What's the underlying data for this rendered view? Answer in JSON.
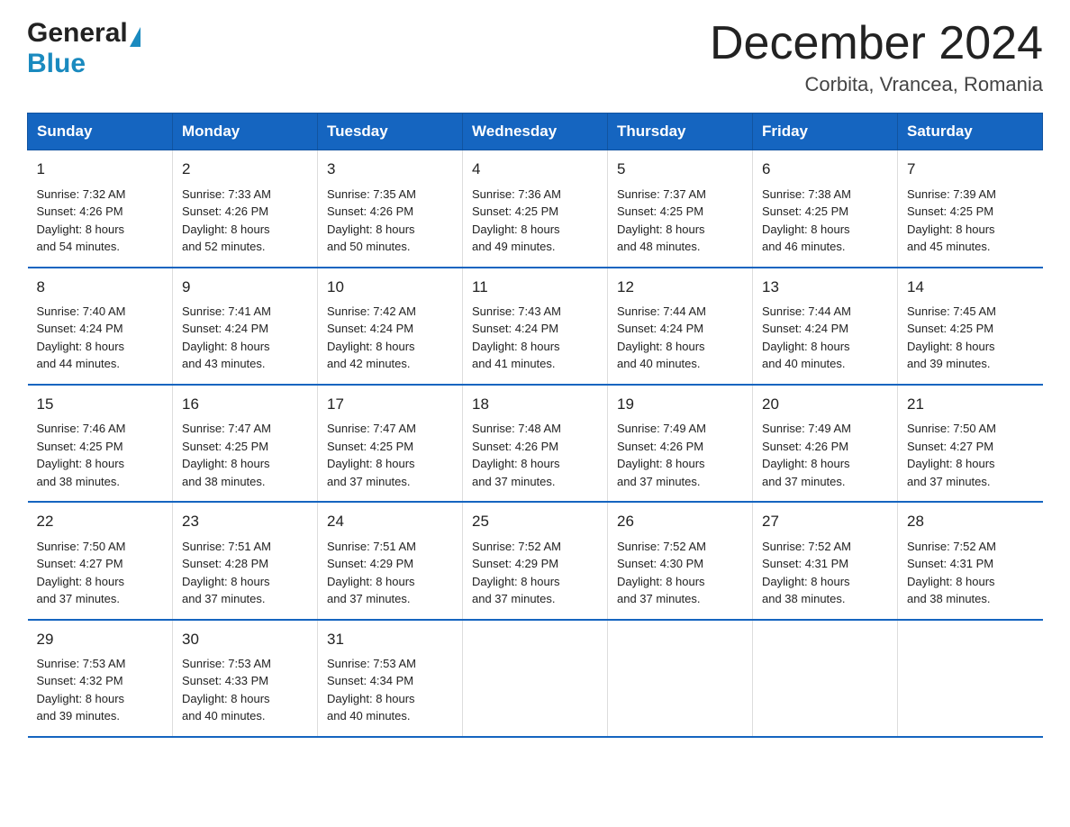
{
  "header": {
    "logo_general": "General",
    "logo_blue": "Blue",
    "title": "December 2024",
    "subtitle": "Corbita, Vrancea, Romania"
  },
  "days_of_week": [
    "Sunday",
    "Monday",
    "Tuesday",
    "Wednesday",
    "Thursday",
    "Friday",
    "Saturday"
  ],
  "weeks": [
    [
      {
        "day": "1",
        "sunrise": "Sunrise: 7:32 AM",
        "sunset": "Sunset: 4:26 PM",
        "daylight": "Daylight: 8 hours",
        "daylight2": "and 54 minutes."
      },
      {
        "day": "2",
        "sunrise": "Sunrise: 7:33 AM",
        "sunset": "Sunset: 4:26 PM",
        "daylight": "Daylight: 8 hours",
        "daylight2": "and 52 minutes."
      },
      {
        "day": "3",
        "sunrise": "Sunrise: 7:35 AM",
        "sunset": "Sunset: 4:26 PM",
        "daylight": "Daylight: 8 hours",
        "daylight2": "and 50 minutes."
      },
      {
        "day": "4",
        "sunrise": "Sunrise: 7:36 AM",
        "sunset": "Sunset: 4:25 PM",
        "daylight": "Daylight: 8 hours",
        "daylight2": "and 49 minutes."
      },
      {
        "day": "5",
        "sunrise": "Sunrise: 7:37 AM",
        "sunset": "Sunset: 4:25 PM",
        "daylight": "Daylight: 8 hours",
        "daylight2": "and 48 minutes."
      },
      {
        "day": "6",
        "sunrise": "Sunrise: 7:38 AM",
        "sunset": "Sunset: 4:25 PM",
        "daylight": "Daylight: 8 hours",
        "daylight2": "and 46 minutes."
      },
      {
        "day": "7",
        "sunrise": "Sunrise: 7:39 AM",
        "sunset": "Sunset: 4:25 PM",
        "daylight": "Daylight: 8 hours",
        "daylight2": "and 45 minutes."
      }
    ],
    [
      {
        "day": "8",
        "sunrise": "Sunrise: 7:40 AM",
        "sunset": "Sunset: 4:24 PM",
        "daylight": "Daylight: 8 hours",
        "daylight2": "and 44 minutes."
      },
      {
        "day": "9",
        "sunrise": "Sunrise: 7:41 AM",
        "sunset": "Sunset: 4:24 PM",
        "daylight": "Daylight: 8 hours",
        "daylight2": "and 43 minutes."
      },
      {
        "day": "10",
        "sunrise": "Sunrise: 7:42 AM",
        "sunset": "Sunset: 4:24 PM",
        "daylight": "Daylight: 8 hours",
        "daylight2": "and 42 minutes."
      },
      {
        "day": "11",
        "sunrise": "Sunrise: 7:43 AM",
        "sunset": "Sunset: 4:24 PM",
        "daylight": "Daylight: 8 hours",
        "daylight2": "and 41 minutes."
      },
      {
        "day": "12",
        "sunrise": "Sunrise: 7:44 AM",
        "sunset": "Sunset: 4:24 PM",
        "daylight": "Daylight: 8 hours",
        "daylight2": "and 40 minutes."
      },
      {
        "day": "13",
        "sunrise": "Sunrise: 7:44 AM",
        "sunset": "Sunset: 4:24 PM",
        "daylight": "Daylight: 8 hours",
        "daylight2": "and 40 minutes."
      },
      {
        "day": "14",
        "sunrise": "Sunrise: 7:45 AM",
        "sunset": "Sunset: 4:25 PM",
        "daylight": "Daylight: 8 hours",
        "daylight2": "and 39 minutes."
      }
    ],
    [
      {
        "day": "15",
        "sunrise": "Sunrise: 7:46 AM",
        "sunset": "Sunset: 4:25 PM",
        "daylight": "Daylight: 8 hours",
        "daylight2": "and 38 minutes."
      },
      {
        "day": "16",
        "sunrise": "Sunrise: 7:47 AM",
        "sunset": "Sunset: 4:25 PM",
        "daylight": "Daylight: 8 hours",
        "daylight2": "and 38 minutes."
      },
      {
        "day": "17",
        "sunrise": "Sunrise: 7:47 AM",
        "sunset": "Sunset: 4:25 PM",
        "daylight": "Daylight: 8 hours",
        "daylight2": "and 37 minutes."
      },
      {
        "day": "18",
        "sunrise": "Sunrise: 7:48 AM",
        "sunset": "Sunset: 4:26 PM",
        "daylight": "Daylight: 8 hours",
        "daylight2": "and 37 minutes."
      },
      {
        "day": "19",
        "sunrise": "Sunrise: 7:49 AM",
        "sunset": "Sunset: 4:26 PM",
        "daylight": "Daylight: 8 hours",
        "daylight2": "and 37 minutes."
      },
      {
        "day": "20",
        "sunrise": "Sunrise: 7:49 AM",
        "sunset": "Sunset: 4:26 PM",
        "daylight": "Daylight: 8 hours",
        "daylight2": "and 37 minutes."
      },
      {
        "day": "21",
        "sunrise": "Sunrise: 7:50 AM",
        "sunset": "Sunset: 4:27 PM",
        "daylight": "Daylight: 8 hours",
        "daylight2": "and 37 minutes."
      }
    ],
    [
      {
        "day": "22",
        "sunrise": "Sunrise: 7:50 AM",
        "sunset": "Sunset: 4:27 PM",
        "daylight": "Daylight: 8 hours",
        "daylight2": "and 37 minutes."
      },
      {
        "day": "23",
        "sunrise": "Sunrise: 7:51 AM",
        "sunset": "Sunset: 4:28 PM",
        "daylight": "Daylight: 8 hours",
        "daylight2": "and 37 minutes."
      },
      {
        "day": "24",
        "sunrise": "Sunrise: 7:51 AM",
        "sunset": "Sunset: 4:29 PM",
        "daylight": "Daylight: 8 hours",
        "daylight2": "and 37 minutes."
      },
      {
        "day": "25",
        "sunrise": "Sunrise: 7:52 AM",
        "sunset": "Sunset: 4:29 PM",
        "daylight": "Daylight: 8 hours",
        "daylight2": "and 37 minutes."
      },
      {
        "day": "26",
        "sunrise": "Sunrise: 7:52 AM",
        "sunset": "Sunset: 4:30 PM",
        "daylight": "Daylight: 8 hours",
        "daylight2": "and 37 minutes."
      },
      {
        "day": "27",
        "sunrise": "Sunrise: 7:52 AM",
        "sunset": "Sunset: 4:31 PM",
        "daylight": "Daylight: 8 hours",
        "daylight2": "and 38 minutes."
      },
      {
        "day": "28",
        "sunrise": "Sunrise: 7:52 AM",
        "sunset": "Sunset: 4:31 PM",
        "daylight": "Daylight: 8 hours",
        "daylight2": "and 38 minutes."
      }
    ],
    [
      {
        "day": "29",
        "sunrise": "Sunrise: 7:53 AM",
        "sunset": "Sunset: 4:32 PM",
        "daylight": "Daylight: 8 hours",
        "daylight2": "and 39 minutes."
      },
      {
        "day": "30",
        "sunrise": "Sunrise: 7:53 AM",
        "sunset": "Sunset: 4:33 PM",
        "daylight": "Daylight: 8 hours",
        "daylight2": "and 40 minutes."
      },
      {
        "day": "31",
        "sunrise": "Sunrise: 7:53 AM",
        "sunset": "Sunset: 4:34 PM",
        "daylight": "Daylight: 8 hours",
        "daylight2": "and 40 minutes."
      },
      null,
      null,
      null,
      null
    ]
  ]
}
